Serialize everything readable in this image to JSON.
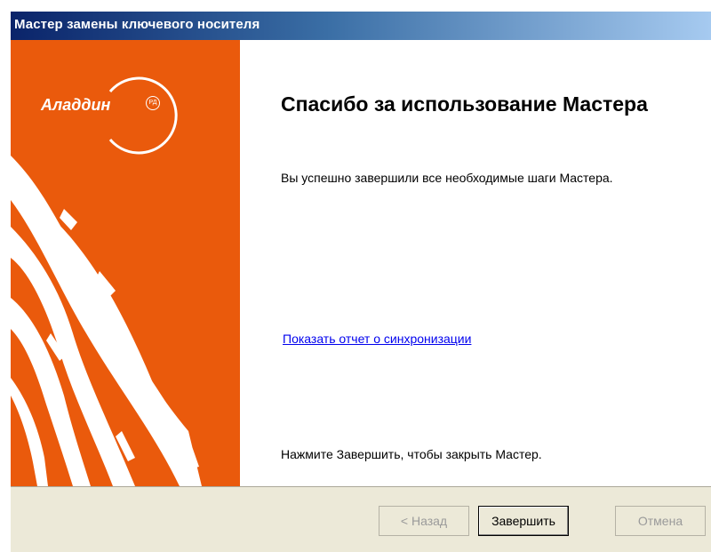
{
  "window": {
    "title": "Мастер замены ключевого носителя"
  },
  "banner": {
    "logo_text": "Аладдин",
    "logo_badge": "РД",
    "color": "#ea5a0c"
  },
  "content": {
    "heading": "Спасибо за использование Мастера",
    "description": "Вы успешно завершили все необходимые шаги Мастера.",
    "sync_link": "Показать отчет о синхронизации",
    "finish_hint": "Нажмите Завершить, чтобы закрыть Мастер."
  },
  "buttons": {
    "back": {
      "label": "< Назад",
      "enabled": false
    },
    "finish": {
      "label": "Завершить",
      "enabled": true
    },
    "cancel": {
      "label": "Отмена",
      "enabled": false
    }
  }
}
